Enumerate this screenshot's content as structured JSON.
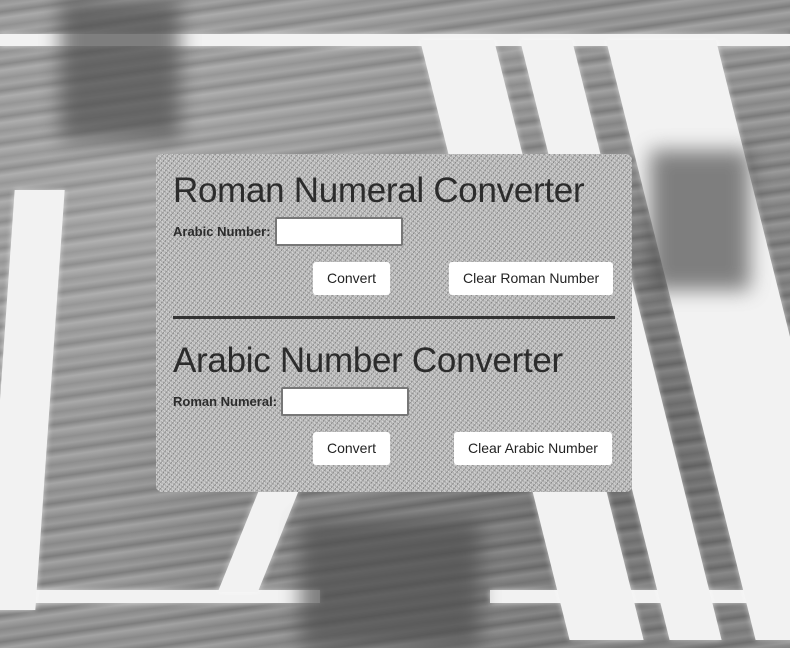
{
  "roman_converter": {
    "title": "Roman Numeral Converter",
    "input_label": "Arabic Number:",
    "input_value": "",
    "input_placeholder": "",
    "convert_label": "Convert",
    "clear_label": "Clear Roman Number"
  },
  "arabic_converter": {
    "title": "Arabic Number Converter",
    "input_label": "Roman Numeral:",
    "input_value": "",
    "input_placeholder": "",
    "convert_label": "Convert",
    "clear_label": "Clear Arabic Number"
  },
  "colors": {
    "panel_background": "#b0b0b0",
    "text": "#2c2c2c",
    "button_background": "#ffffff",
    "divider": "#333333"
  }
}
